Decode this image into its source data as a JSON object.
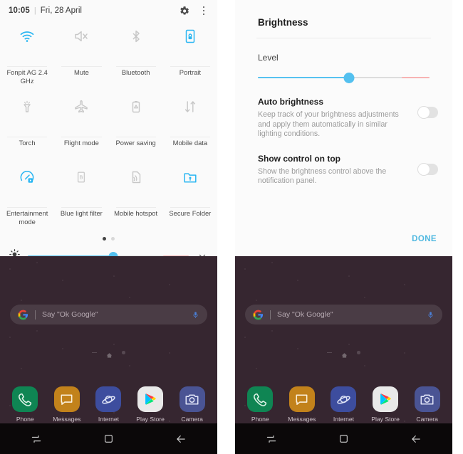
{
  "quick_settings": {
    "status": {
      "time": "10:05",
      "separator": "|",
      "date": "Fri, 28 April"
    },
    "gear_icon": "gear-icon",
    "overflow_icon": "kebab-menu-icon",
    "tiles": [
      {
        "label": "Fonpit AG 2.4 GHz",
        "icon": "wifi-icon",
        "active": true
      },
      {
        "label": "Mute",
        "icon": "mute-icon",
        "active": false
      },
      {
        "label": "Bluetooth",
        "icon": "bluetooth-icon",
        "active": false
      },
      {
        "label": "Portrait",
        "icon": "screen-rotation-lock-icon",
        "active": true
      },
      {
        "label": "Torch",
        "icon": "torch-icon",
        "active": false
      },
      {
        "label": "Flight mode",
        "icon": "airplane-icon",
        "active": false
      },
      {
        "label": "Power saving",
        "icon": "battery-saver-icon",
        "active": false
      },
      {
        "label": "Mobile data",
        "icon": "mobile-data-icon",
        "active": false
      },
      {
        "label": "Entertainment mode",
        "icon": "entertainment-mode-icon",
        "active": true
      },
      {
        "label": "Blue light filter",
        "icon": "blue-light-filter-icon",
        "active": false
      },
      {
        "label": "Mobile hotspot",
        "icon": "hotspot-icon",
        "active": false
      },
      {
        "label": "Secure Folder",
        "icon": "secure-folder-icon",
        "active": true
      }
    ],
    "page_indicator": {
      "pages": 2,
      "current": 1
    },
    "brightness": {
      "icon": "brightness-icon",
      "value_percent": 53,
      "warm_tail_start_percent": 84,
      "expand_icon": "chevron-down-icon"
    },
    "handle_icon": "drag-handle-icon"
  },
  "brightness_settings": {
    "title": "Brightness",
    "level_label": "Level",
    "slider": {
      "value_percent": 53,
      "warm_tail_start_percent": 84
    },
    "options": [
      {
        "title": "Auto brightness",
        "description": "Keep track of your brightness adjustments and apply them automatically in similar lighting conditions.",
        "toggle_on": false
      },
      {
        "title": "Show control on top",
        "description": "Show the brightness control above the notification panel.",
        "toggle_on": false
      }
    ],
    "done_label": "DONE"
  },
  "home_screen": {
    "search": {
      "google_icon": "google-g-icon",
      "placeholder": "Say \"Ok Google\"",
      "mic_icon": "microphone-icon"
    },
    "page_indicator": {
      "left_icon": "page-dash-icon",
      "home_icon": "home-page-icon",
      "right_icon": "page-dot-icon"
    },
    "dock": [
      {
        "label": "Phone",
        "icon": "phone-icon",
        "color": "#0f8553"
      },
      {
        "label": "Messages",
        "icon": "messages-icon",
        "color": "#c2821b"
      },
      {
        "label": "Internet",
        "icon": "internet-browser-icon",
        "color": "#3d4d9e"
      },
      {
        "label": "Play Store",
        "icon": "play-store-icon",
        "color": "#e9e9e9"
      },
      {
        "label": "Camera",
        "icon": "camera-icon",
        "color": "#4a5494"
      }
    ],
    "navbar": [
      {
        "name": "recents-button",
        "icon": "recents-icon"
      },
      {
        "name": "home-button",
        "icon": "home-square-icon"
      },
      {
        "name": "back-button",
        "icon": "back-arrow-icon"
      }
    ]
  },
  "colors": {
    "accent_blue": "#4fb8e0",
    "slider_blue": "#56c2f0",
    "slider_warm": "#f7b3b3",
    "panel_bg": "#fafafa",
    "wallpaper": "#362630"
  }
}
